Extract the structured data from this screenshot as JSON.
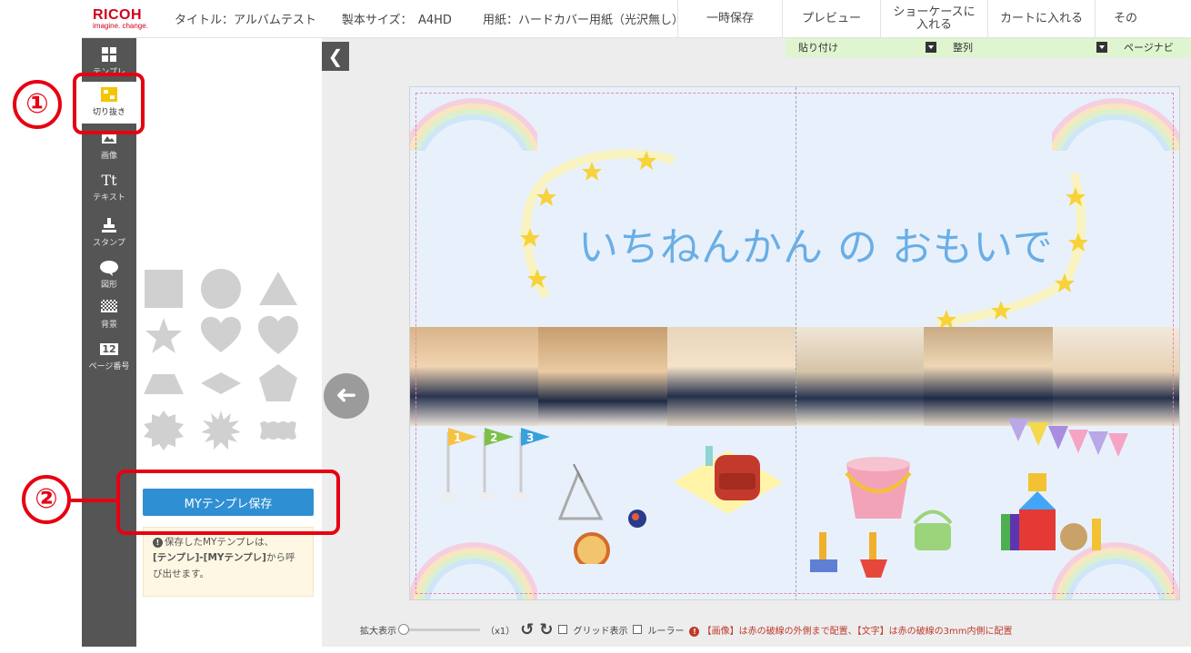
{
  "header": {
    "logo_brand": "RICOH",
    "logo_tagline": "imagine. change.",
    "title": "タイトル：アルバムテスト",
    "size": "製本サイズ：　A4HD",
    "paper": "用紙：ハードカバー用紙（光沢無し）",
    "buttons": {
      "save_temp": "一時保存",
      "preview": "プレビュー",
      "showcase_l1": "ショーケースに",
      "showcase_l2": "入れる",
      "cart": "カートに入れる",
      "other": "その"
    }
  },
  "toolbar": {
    "items": [
      {
        "label": "テンプレ",
        "icon": "template-grid-icon"
      },
      {
        "label": "切り抜き",
        "icon": "crop-frame-icon"
      },
      {
        "label": "画像",
        "icon": "image-icon"
      },
      {
        "label": "テキスト",
        "icon": "text-tt-icon",
        "glyph": "Tt"
      },
      {
        "label": "スタンプ",
        "icon": "stamp-icon"
      },
      {
        "label": "図形",
        "icon": "speech-bubble-icon"
      },
      {
        "label": "背景",
        "icon": "background-pattern-icon"
      },
      {
        "label": "ページ番号",
        "icon": "page-number-icon",
        "glyph": "12"
      }
    ]
  },
  "panel": {
    "my_template_button": "MYテンプレ保存",
    "info_line1": "保存したMYテンプレは、",
    "info_line2_bold": "[テンプレ]-[MYテンプレ]",
    "info_line2_rest": "から呼",
    "info_line3": "び出せます。",
    "info_icon": "!"
  },
  "subbar": {
    "paste": "貼り付け",
    "align": "整列",
    "page_navi": "ページナビ"
  },
  "canvas": {
    "title_text": "いちねんかん の おもいで",
    "flags": [
      "1",
      "2",
      "3"
    ],
    "collapse_glyph": "❮",
    "prev_glyph": "➜"
  },
  "bottombar": {
    "zoom_label": "拡大表示",
    "zoom_value": "（x1）",
    "undo_glyph": "↺",
    "redo_glyph": "↻",
    "grid_label": "グリッド表示",
    "ruler_label": "ルーラー",
    "warning": "【画像】は赤の破線の外側まで配置、【文字】は赤の破線の3mm内側に配置",
    "warning_icon": "!"
  },
  "annotations": {
    "marker1": "①",
    "marker2": "②"
  },
  "colors": {
    "accent_blue": "#2f8fd3",
    "toolbar_gray": "#555555",
    "annotation_red": "#e60012",
    "title_blue": "#6aaee6",
    "subbar_green": "#dff5cf"
  }
}
